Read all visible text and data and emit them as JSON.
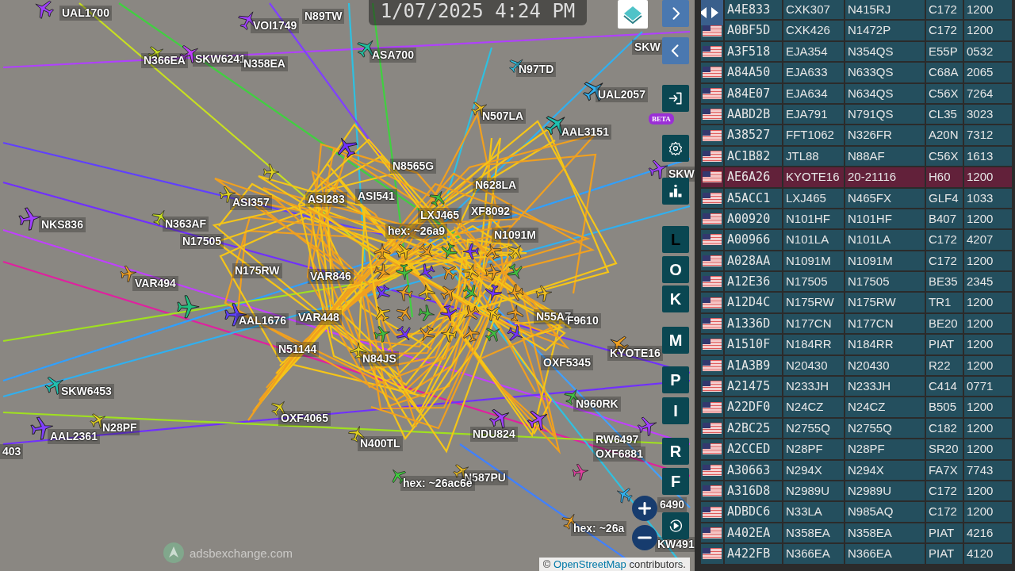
{
  "clock": "1/07/2025 4:24 PM",
  "map_labels": [
    "UAL1700",
    "VOI1749",
    "N89TW",
    "ASA700",
    "N97TD",
    "UAL2057",
    "N507LA",
    "AAL3151",
    "N366EA",
    "SKW6241",
    "N358EA",
    "SKW",
    "SKW",
    "NKS836",
    "N363AF",
    "ASI357",
    "ASI283",
    "ASI541",
    "N8565G",
    "N628LA",
    "LXJ465",
    "XF8092",
    "hex: ~26a9",
    "N1091M",
    "N17505",
    "N175RW",
    "VAR494",
    "VAR846",
    "VAR448",
    "AAL1676",
    "N51144",
    "N55AZ",
    "F9610",
    "KYOTE16",
    "N84JS",
    "OXF5345",
    "SKW6453",
    "AAL2361",
    "N28PF",
    "OXF4065",
    "N400TL",
    "NDU824",
    "N960RK",
    "RW6497",
    "OXF6881",
    "N587PU",
    "hex: ~26ac6e",
    "hex: ~26a",
    "6490",
    "KW491",
    "403"
  ],
  "beta_badge": "BETA",
  "letter_buttons": [
    {
      "label": "L",
      "selected": true
    },
    {
      "label": "O",
      "selected": false
    },
    {
      "label": "K",
      "selected": false
    },
    {
      "label": "M",
      "selected": false
    },
    {
      "label": "P",
      "selected": false
    },
    {
      "label": "I",
      "selected": false
    },
    {
      "label": "R",
      "selected": false
    },
    {
      "label": "F",
      "selected": false
    }
  ],
  "logo": "adsbexchange.com",
  "attribution": {
    "symbol": "©",
    "link": "OpenStreetMap",
    "text": "contributors."
  },
  "aircraft_table": {
    "rows": [
      {
        "cells": [
          "A4E833",
          "CXK307",
          "N415RJ",
          "C172",
          "1200"
        ],
        "selected": false
      },
      {
        "cells": [
          "A0BF5D",
          "CXK426",
          "N1472P",
          "C172",
          "1200"
        ],
        "selected": false
      },
      {
        "cells": [
          "A3F518",
          "EJA354",
          "N354QS",
          "E55P",
          "0532"
        ],
        "selected": false
      },
      {
        "cells": [
          "A84A50",
          "EJA633",
          "N633QS",
          "C68A",
          "2065"
        ],
        "selected": false
      },
      {
        "cells": [
          "A84E07",
          "EJA634",
          "N634QS",
          "C56X",
          "7264"
        ],
        "selected": false
      },
      {
        "cells": [
          "AABD2B",
          "EJA791",
          "N791QS",
          "CL35",
          "3023"
        ],
        "selected": false
      },
      {
        "cells": [
          "A38527",
          "FFT1062",
          "N326FR",
          "A20N",
          "7312"
        ],
        "selected": false
      },
      {
        "cells": [
          "AC1B82",
          "JTL88",
          "N88AF",
          "C56X",
          "1613"
        ],
        "selected": false
      },
      {
        "cells": [
          "AE6A26",
          "KYOTE16",
          "20-21116",
          "H60",
          "1200"
        ],
        "selected": true
      },
      {
        "cells": [
          "A5ACC1",
          "LXJ465",
          "N465FX",
          "GLF4",
          "1033"
        ],
        "selected": false
      },
      {
        "cells": [
          "A00920",
          "N101HF",
          "N101HF",
          "B407",
          "1200"
        ],
        "selected": false
      },
      {
        "cells": [
          "A00966",
          "N101LA",
          "N101LA",
          "C172",
          "4207"
        ],
        "selected": false
      },
      {
        "cells": [
          "A028AA",
          "N1091M",
          "N1091M",
          "C172",
          "1200"
        ],
        "selected": false
      },
      {
        "cells": [
          "A12E36",
          "N17505",
          "N17505",
          "BE35",
          "2345"
        ],
        "selected": false
      },
      {
        "cells": [
          "A12D4C",
          "N175RW",
          "N175RW",
          "TR1",
          "1200"
        ],
        "selected": false
      },
      {
        "cells": [
          "A1336D",
          "N177CN",
          "N177CN",
          "BE20",
          "1200"
        ],
        "selected": false
      },
      {
        "cells": [
          "A1510F",
          "N184RR",
          "N184RR",
          "PIAT",
          "1200"
        ],
        "selected": false
      },
      {
        "cells": [
          "A1A3B9",
          "N20430",
          "N20430",
          "R22",
          "1200"
        ],
        "selected": false
      },
      {
        "cells": [
          "A21475",
          "N233JH",
          "N233JH",
          "C414",
          "0771"
        ],
        "selected": false
      },
      {
        "cells": [
          "A22DF0",
          "N24CZ",
          "N24CZ",
          "B505",
          "1200"
        ],
        "selected": false
      },
      {
        "cells": [
          "A2BC25",
          "N2755Q",
          "N2755Q",
          "C182",
          "1200"
        ],
        "selected": false
      },
      {
        "cells": [
          "A2CCED",
          "N28PF",
          "N28PF",
          "SR20",
          "1200"
        ],
        "selected": false
      },
      {
        "cells": [
          "A30663",
          "N294X",
          "N294X",
          "FA7X",
          "7743"
        ],
        "selected": false
      },
      {
        "cells": [
          "A316D8",
          "N2989U",
          "N2989U",
          "C172",
          "1200"
        ],
        "selected": false
      },
      {
        "cells": [
          "ADBDC6",
          "N33LA",
          "N985AQ",
          "C172",
          "1200"
        ],
        "selected": false
      },
      {
        "cells": [
          "A402EA",
          "N358EA",
          "N358EA",
          "PIAT",
          "4216"
        ],
        "selected": false
      },
      {
        "cells": [
          "A422FB",
          "N366EA",
          "N366EA",
          "PIAT",
          "4120"
        ],
        "selected": false
      }
    ]
  }
}
